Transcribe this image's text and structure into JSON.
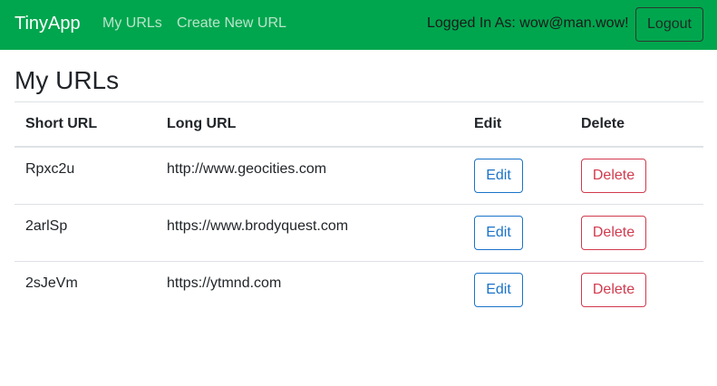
{
  "navbar": {
    "brand": "TinyApp",
    "links": [
      "My URLs",
      "Create New URL"
    ],
    "logged_in_text": "Logged In As: wow@man.wow!",
    "logout_label": "Logout"
  },
  "main": {
    "title": "My URLs",
    "table": {
      "headers": [
        "Short URL",
        "Long URL",
        "Edit",
        "Delete"
      ],
      "rows": [
        {
          "short": "Rpxc2u",
          "long": "http://www.geocities.com",
          "edit": "Edit",
          "delete": "Delete"
        },
        {
          "short": "2arlSp",
          "long": "https://www.brodyquest.com",
          "edit": "Edit",
          "delete": "Delete"
        },
        {
          "short": "2sJeVm",
          "long": "https://ytmnd.com",
          "edit": "Edit",
          "delete": "Delete"
        }
      ]
    }
  },
  "colors": {
    "navbar_bg": "#00a64e",
    "edit_accent": "#1a73c9",
    "delete_accent": "#d23a4d"
  }
}
